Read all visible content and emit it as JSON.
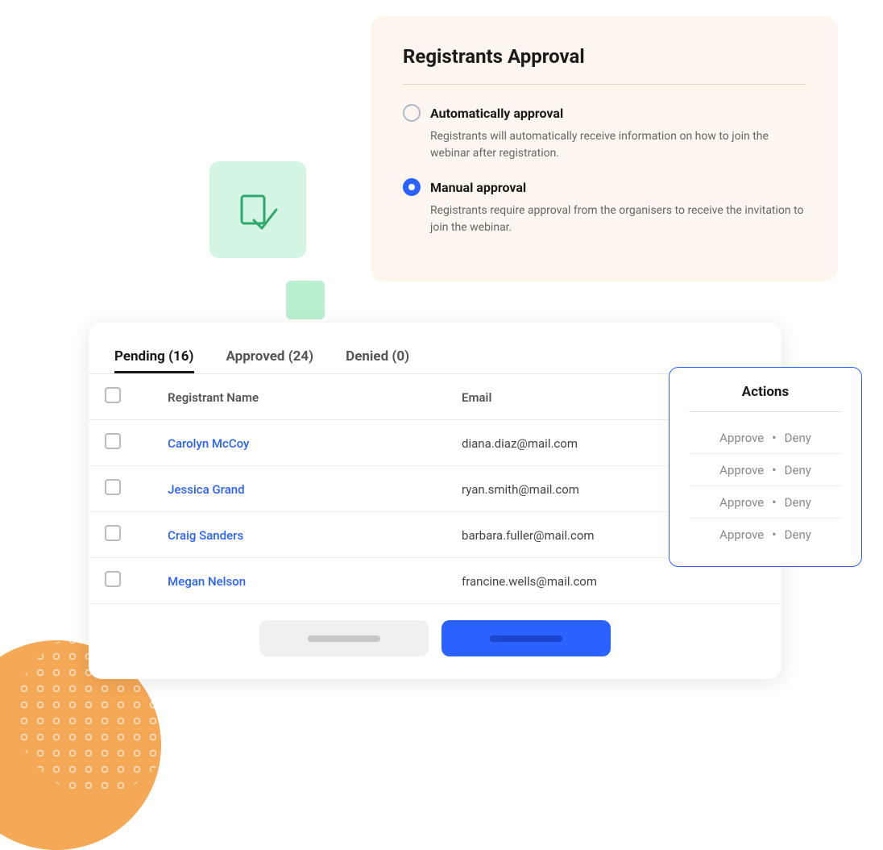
{
  "approval_panel": {
    "title": "Registrants Approval",
    "option_auto_label": "Automatically approval",
    "option_auto_desc": "Registrants will automatically receive information on how to join the webinar after registration.",
    "option_manual_label": "Manual approval",
    "option_manual_desc": "Registrants require approval from the organisers to receive the invitation to join the webinar.",
    "auto_selected": false,
    "manual_selected": true
  },
  "tabs": [
    {
      "label": "Pending (16)",
      "active": true
    },
    {
      "label": "Approved (24)",
      "active": false
    },
    {
      "label": "Denied (0)",
      "active": false
    }
  ],
  "table": {
    "columns": [
      "Registrant Name",
      "Email"
    ],
    "rows": [
      {
        "name": "Carolyn McCoy",
        "email": "diana.diaz@mail.com"
      },
      {
        "name": "Jessica Grand",
        "email": "ryan.smith@mail.com"
      },
      {
        "name": "Craig Sanders",
        "email": "barbara.fuller@mail.com"
      },
      {
        "name": "Megan Nelson",
        "email": "francine.wells@mail.com"
      }
    ]
  },
  "buttons": {
    "secondary_label": "",
    "primary_label": ""
  },
  "actions_panel": {
    "title": "Actions",
    "rows": [
      {
        "approve": "Approve",
        "dot": "•",
        "deny": "Deny"
      },
      {
        "approve": "Approve",
        "dot": "•",
        "deny": "Deny"
      },
      {
        "approve": "Approve",
        "dot": "•",
        "deny": "Deny"
      },
      {
        "approve": "Approve",
        "dot": "•",
        "deny": "Deny"
      }
    ]
  }
}
